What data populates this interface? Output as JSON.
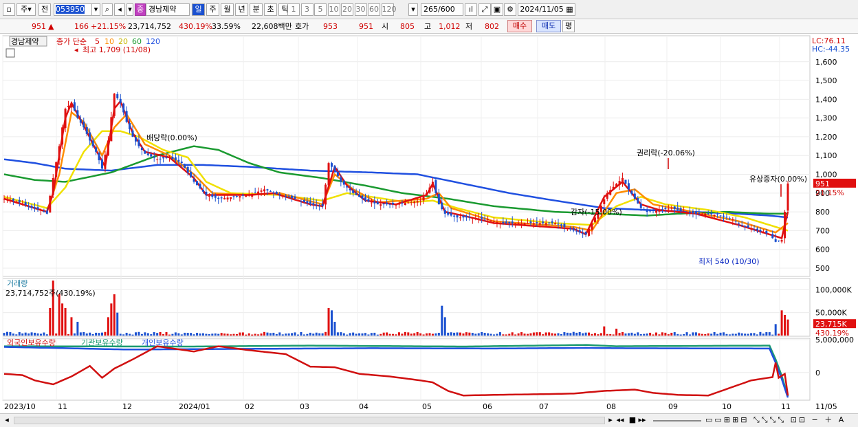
{
  "toolbar": {
    "market": "주",
    "prev_label": "전",
    "code": "053950",
    "stock_name": "경남제약",
    "stock_badge": "중",
    "periods": [
      "일",
      "주",
      "월",
      "년",
      "분",
      "초",
      "틱"
    ],
    "active_period": "일",
    "intervals": [
      "1",
      "3",
      "5",
      "10",
      "20",
      "30",
      "60",
      "120"
    ],
    "count": "265",
    "count_max": "/600",
    "date": "2024/11/05"
  },
  "quote": {
    "price": "951",
    "change_arrow": "▲",
    "change": "166",
    "change_pct": "+21.15%",
    "volume": "23,714,752",
    "volume_pct": "430.19%",
    "turnover": "33.59%",
    "amount": "22,608백만",
    "hoga_label": "호가",
    "ask": "953",
    "bid": "951",
    "open_label": "시",
    "open": "805",
    "high_label": "고",
    "high": "1,012",
    "low_label": "저",
    "low": "802",
    "buy_label": "매수",
    "sell_label": "매도",
    "eval_label": "평"
  },
  "price_panel": {
    "name_tag": "경남제약",
    "ma_label": "종가 단순",
    "ma_periods": [
      "5",
      "10",
      "20",
      "60",
      "120"
    ],
    "lc": "LC:76.11",
    "hc": "HC:-44.35",
    "current_price_tag": "951",
    "current_pct_tag": "21.15%",
    "annotations": {
      "high": "최고 1,709 (11/08)",
      "low": "최저 540 (10/30)",
      "ann1": "배당락(0.00%)",
      "ann2": "권리락(-20.06%)",
      "ann3": "감자(-15.00%)",
      "ann4": "유상증자(0.00%)"
    }
  },
  "volume_panel": {
    "title": "거래량",
    "info": "23,714,752주(430.19%)",
    "tag_value": "23,715K",
    "tag_pct": "430.19%"
  },
  "holding_panel": {
    "legend": [
      "외국인보유수량",
      "기관보유수량",
      "개인보유수량"
    ]
  },
  "colors": {
    "up": "#e01010",
    "down": "#1a50d0",
    "ma5": "#e01010",
    "ma10": "#ff8c00",
    "ma20": "#f0e000",
    "ma60": "#1a9a30",
    "ma120": "#2050e0",
    "foreign": "#d01010",
    "institution": "#1a9a70",
    "individual": "#2050e0"
  },
  "chart_data": {
    "type": "candlestick",
    "x_tick_labels": [
      "2023/10",
      "11",
      "12",
      "2024/01",
      "02",
      "03",
      "04",
      "05",
      "06",
      "07",
      "08",
      "09",
      "10",
      "11",
      "11/05"
    ],
    "price_ticks": [
      "1,600",
      "1,500",
      "1,400",
      "1,300",
      "1,200",
      "1,100",
      "1,000",
      "900",
      "800",
      "700",
      "600",
      "500"
    ],
    "price_tick_values": [
      1600,
      1500,
      1400,
      1300,
      1200,
      1100,
      1000,
      900,
      800,
      700,
      600,
      500
    ],
    "volume_ticks": [
      "100,000K",
      "50,000K"
    ],
    "volume_tick_values": [
      100000,
      50000
    ],
    "holding_ticks": [
      "5,000,000",
      "0"
    ],
    "holding_tick_values": [
      5000000,
      0
    ],
    "close_keypoints": [
      [
        0,
        870
      ],
      [
        3,
        860
      ],
      [
        6,
        845
      ],
      [
        9,
        820
      ],
      [
        12,
        810
      ],
      [
        14,
        790
      ],
      [
        16,
        980
      ],
      [
        18,
        1150
      ],
      [
        20,
        1350
      ],
      [
        22,
        1380
      ],
      [
        24,
        1300
      ],
      [
        26,
        1250
      ],
      [
        28,
        1180
      ],
      [
        30,
        1120
      ],
      [
        32,
        1030
      ],
      [
        34,
        1180
      ],
      [
        36,
        1430
      ],
      [
        38,
        1380
      ],
      [
        40,
        1280
      ],
      [
        42,
        1200
      ],
      [
        44,
        1150
      ],
      [
        46,
        1110
      ],
      [
        50,
        1080
      ],
      [
        54,
        1090
      ],
      [
        58,
        1060
      ],
      [
        62,
        960
      ],
      [
        66,
        890
      ],
      [
        70,
        870
      ],
      [
        75,
        880
      ],
      [
        80,
        890
      ],
      [
        85,
        920
      ],
      [
        90,
        890
      ],
      [
        95,
        870
      ],
      [
        100,
        840
      ],
      [
        104,
        830
      ],
      [
        106,
        1060
      ],
      [
        108,
        1020
      ],
      [
        110,
        960
      ],
      [
        114,
        900
      ],
      [
        118,
        860
      ],
      [
        122,
        840
      ],
      [
        128,
        840
      ],
      [
        132,
        850
      ],
      [
        136,
        860
      ],
      [
        138,
        900
      ],
      [
        140,
        960
      ],
      [
        142,
        840
      ],
      [
        144,
        790
      ],
      [
        148,
        770
      ],
      [
        152,
        770
      ],
      [
        158,
        760
      ],
      [
        162,
        740
      ],
      [
        168,
        740
      ],
      [
        174,
        740
      ],
      [
        180,
        740
      ],
      [
        186,
        700
      ],
      [
        190,
        680
      ],
      [
        194,
        800
      ],
      [
        197,
        900
      ],
      [
        200,
        950
      ],
      [
        202,
        980
      ],
      [
        204,
        920
      ],
      [
        206,
        870
      ],
      [
        208,
        820
      ],
      [
        210,
        800
      ],
      [
        214,
        810
      ],
      [
        218,
        820
      ],
      [
        222,
        800
      ],
      [
        226,
        790
      ],
      [
        230,
        790
      ],
      [
        234,
        780
      ],
      [
        238,
        760
      ],
      [
        242,
        720
      ],
      [
        246,
        700
      ],
      [
        250,
        680
      ],
      [
        252,
        640
      ],
      [
        254,
        650
      ],
      [
        255,
        800
      ],
      [
        256,
        951
      ]
    ],
    "ma_series": [
      {
        "name": "5",
        "keypoints": [
          [
            0,
            870
          ],
          [
            14,
            800
          ],
          [
            16,
            900
          ],
          [
            20,
            1300
          ],
          [
            22,
            1380
          ],
          [
            26,
            1260
          ],
          [
            30,
            1130
          ],
          [
            33,
            1040
          ],
          [
            36,
            1350
          ],
          [
            38,
            1390
          ],
          [
            42,
            1220
          ],
          [
            46,
            1120
          ],
          [
            54,
            1090
          ],
          [
            62,
            980
          ],
          [
            66,
            890
          ],
          [
            80,
            890
          ],
          [
            88,
            900
          ],
          [
            100,
            840
          ],
          [
            104,
            830
          ],
          [
            108,
            1040
          ],
          [
            112,
            940
          ],
          [
            118,
            860
          ],
          [
            128,
            840
          ],
          [
            138,
            890
          ],
          [
            140,
            950
          ],
          [
            144,
            800
          ],
          [
            150,
            780
          ],
          [
            160,
            740
          ],
          [
            186,
            710
          ],
          [
            190,
            680
          ],
          [
            196,
            880
          ],
          [
            202,
            960
          ],
          [
            208,
            840
          ],
          [
            214,
            810
          ],
          [
            226,
            790
          ],
          [
            240,
            730
          ],
          [
            250,
            680
          ],
          [
            254,
            660
          ],
          [
            256,
            800
          ]
        ]
      },
      {
        "name": "10",
        "keypoints": [
          [
            0,
            870
          ],
          [
            14,
            800
          ],
          [
            18,
            1000
          ],
          [
            22,
            1330
          ],
          [
            26,
            1280
          ],
          [
            32,
            1100
          ],
          [
            36,
            1250
          ],
          [
            40,
            1320
          ],
          [
            46,
            1160
          ],
          [
            54,
            1100
          ],
          [
            62,
            1000
          ],
          [
            68,
            900
          ],
          [
            80,
            890
          ],
          [
            90,
            900
          ],
          [
            104,
            840
          ],
          [
            108,
            1000
          ],
          [
            114,
            920
          ],
          [
            122,
            850
          ],
          [
            138,
            870
          ],
          [
            142,
            900
          ],
          [
            146,
            820
          ],
          [
            160,
            750
          ],
          [
            186,
            720
          ],
          [
            192,
            700
          ],
          [
            200,
            900
          ],
          [
            206,
            920
          ],
          [
            212,
            840
          ],
          [
            222,
            810
          ],
          [
            240,
            750
          ],
          [
            252,
            690
          ],
          [
            256,
            740
          ]
        ]
      },
      {
        "name": "20",
        "keypoints": [
          [
            0,
            880
          ],
          [
            14,
            820
          ],
          [
            20,
            930
          ],
          [
            26,
            1120
          ],
          [
            32,
            1230
          ],
          [
            38,
            1230
          ],
          [
            44,
            1200
          ],
          [
            52,
            1130
          ],
          [
            60,
            1090
          ],
          [
            66,
            960
          ],
          [
            74,
            900
          ],
          [
            90,
            890
          ],
          [
            104,
            860
          ],
          [
            112,
            900
          ],
          [
            120,
            880
          ],
          [
            132,
            850
          ],
          [
            140,
            860
          ],
          [
            148,
            820
          ],
          [
            160,
            770
          ],
          [
            180,
            740
          ],
          [
            192,
            730
          ],
          [
            200,
            830
          ],
          [
            208,
            880
          ],
          [
            216,
            840
          ],
          [
            230,
            810
          ],
          [
            242,
            770
          ],
          [
            252,
            720
          ],
          [
            256,
            700
          ]
        ]
      },
      {
        "name": "60",
        "keypoints": [
          [
            0,
            1000
          ],
          [
            10,
            970
          ],
          [
            20,
            960
          ],
          [
            35,
            1010
          ],
          [
            50,
            1100
          ],
          [
            62,
            1150
          ],
          [
            70,
            1130
          ],
          [
            80,
            1060
          ],
          [
            90,
            1010
          ],
          [
            104,
            980
          ],
          [
            118,
            940
          ],
          [
            130,
            900
          ],
          [
            145,
            870
          ],
          [
            160,
            830
          ],
          [
            180,
            800
          ],
          [
            196,
            790
          ],
          [
            210,
            780
          ],
          [
            220,
            790
          ],
          [
            236,
            800
          ],
          [
            250,
            790
          ],
          [
            256,
            790
          ]
        ]
      },
      {
        "name": "120",
        "keypoints": [
          [
            0,
            1080
          ],
          [
            10,
            1060
          ],
          [
            20,
            1030
          ],
          [
            35,
            1020
          ],
          [
            50,
            1050
          ],
          [
            65,
            1050
          ],
          [
            80,
            1040
          ],
          [
            100,
            1020
          ],
          [
            120,
            1010
          ],
          [
            135,
            1000
          ],
          [
            150,
            950
          ],
          [
            165,
            900
          ],
          [
            180,
            860
          ],
          [
            196,
            820
          ],
          [
            210,
            810
          ],
          [
            225,
            800
          ],
          [
            240,
            790
          ],
          [
            250,
            780
          ],
          [
            256,
            770
          ]
        ]
      }
    ],
    "volume_keypoints": [
      [
        15,
        60000
      ],
      [
        16,
        120000
      ],
      [
        18,
        90000
      ],
      [
        19,
        70000
      ],
      [
        20,
        60000
      ],
      [
        22,
        40000
      ],
      [
        24,
        30000
      ],
      [
        34,
        40000
      ],
      [
        35,
        70000
      ],
      [
        36,
        90000
      ],
      [
        37,
        50000
      ],
      [
        106,
        60000
      ],
      [
        107,
        55000
      ],
      [
        108,
        30000
      ],
      [
        143,
        65000
      ],
      [
        144,
        40000
      ],
      [
        196,
        20000
      ],
      [
        200,
        15000
      ],
      [
        252,
        25000
      ],
      [
        254,
        55000
      ],
      [
        255,
        45000
      ],
      [
        256,
        35000
      ]
    ],
    "foreign_keypoints": [
      [
        0,
        -200000
      ],
      [
        6,
        -400000
      ],
      [
        10,
        -1200000
      ],
      [
        16,
        -1800000
      ],
      [
        22,
        -600000
      ],
      [
        28,
        1000000
      ],
      [
        32,
        -800000
      ],
      [
        36,
        600000
      ],
      [
        42,
        2000000
      ],
      [
        50,
        4000000
      ],
      [
        56,
        3600000
      ],
      [
        62,
        3200000
      ],
      [
        70,
        4000000
      ],
      [
        80,
        3400000
      ],
      [
        92,
        2800000
      ],
      [
        100,
        900000
      ],
      [
        108,
        800000
      ],
      [
        116,
        -200000
      ],
      [
        126,
        -600000
      ],
      [
        136,
        -1200000
      ],
      [
        140,
        -1500000
      ],
      [
        145,
        -2800000
      ],
      [
        150,
        -3500000
      ],
      [
        160,
        -3400000
      ],
      [
        175,
        -3300000
      ],
      [
        186,
        -3200000
      ],
      [
        196,
        -2800000
      ],
      [
        206,
        -2600000
      ],
      [
        212,
        -3100000
      ],
      [
        220,
        -3400000
      ],
      [
        230,
        -3500000
      ],
      [
        244,
        -1200000
      ],
      [
        251,
        -700000
      ],
      [
        252,
        1500000
      ],
      [
        253,
        -800000
      ],
      [
        255,
        -200000
      ],
      [
        256,
        -3500000
      ]
    ],
    "institution_keypoints": [
      [
        0,
        4000000
      ],
      [
        60,
        3950000
      ],
      [
        100,
        4100000
      ],
      [
        150,
        3950000
      ],
      [
        190,
        4200000
      ],
      [
        200,
        4000000
      ],
      [
        250,
        4100000
      ],
      [
        252,
        2000000
      ],
      [
        254,
        -500000
      ],
      [
        256,
        -3600000
      ]
    ],
    "individual_keypoints": [
      [
        0,
        3900000
      ],
      [
        40,
        3500000
      ],
      [
        80,
        3600000
      ],
      [
        120,
        3700000
      ],
      [
        160,
        3650000
      ],
      [
        190,
        3750000
      ],
      [
        200,
        3700000
      ],
      [
        250,
        3650000
      ],
      [
        252,
        1500000
      ],
      [
        254,
        -1000000
      ],
      [
        256,
        -3800000
      ]
    ],
    "price_ylim": [
      500,
      1709
    ],
    "volume_ylim": [
      0,
      120000
    ],
    "holding_ylim": [
      -4000000,
      5000000
    ]
  }
}
